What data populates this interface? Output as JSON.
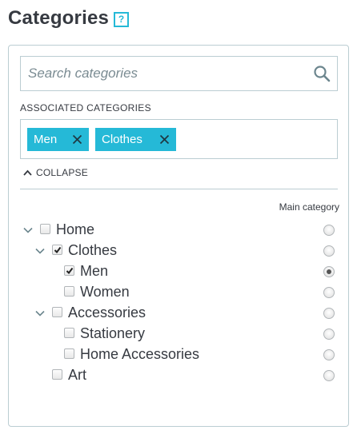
{
  "header": {
    "title": "Categories",
    "help_label": "?"
  },
  "search": {
    "placeholder": "Search categories",
    "value": ""
  },
  "associated": {
    "label": "ASSOCIATED CATEGORIES",
    "tags": [
      {
        "label": "Men"
      },
      {
        "label": "Clothes"
      }
    ]
  },
  "collapse_label": "COLLAPSE",
  "tree": {
    "main_category_header": "Main category",
    "items": [
      {
        "label": "Home",
        "checked": false,
        "expanded": true,
        "main": false
      },
      {
        "label": "Clothes",
        "checked": true,
        "expanded": true,
        "main": false
      },
      {
        "label": "Men",
        "checked": true,
        "expanded": false,
        "main": true
      },
      {
        "label": "Women",
        "checked": false,
        "expanded": false,
        "main": false
      },
      {
        "label": "Accessories",
        "checked": false,
        "expanded": true,
        "main": false
      },
      {
        "label": "Stationery",
        "checked": false,
        "expanded": false,
        "main": false
      },
      {
        "label": "Home Accessories",
        "checked": false,
        "expanded": false,
        "main": false
      },
      {
        "label": "Art",
        "checked": false,
        "expanded": false,
        "main": false
      }
    ]
  },
  "colors": {
    "accent": "#25b9d7",
    "border": "#bbcdd2",
    "text": "#363a41"
  }
}
